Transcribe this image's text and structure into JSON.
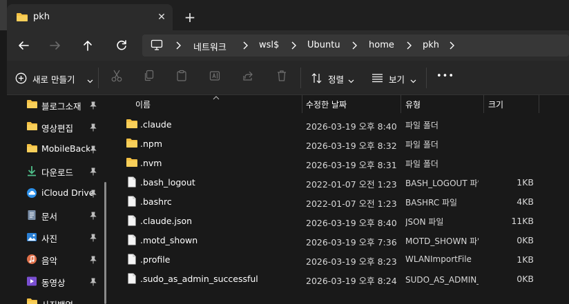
{
  "tab": {
    "title": "pkh",
    "close": "✕",
    "new": "+"
  },
  "address": {
    "crumbs": [
      "네트워크",
      "wsl$",
      "Ubuntu",
      "home",
      "pkh"
    ]
  },
  "toolbar": {
    "new_label": "새로 만들기",
    "sort_label": "정렬",
    "view_label": "보기",
    "more_label": "•••"
  },
  "sidebar": {
    "items": [
      {
        "label": "블로그소재",
        "icon": "folder-icon"
      },
      {
        "label": "영상편집",
        "icon": "folder-icon"
      },
      {
        "label": "MobileBackup",
        "icon": "folder-icon"
      },
      {
        "label": "다운로드",
        "icon": "download-icon"
      },
      {
        "label": "iCloud Drive",
        "icon": "icloud-icon"
      },
      {
        "label": "문서",
        "icon": "document-icon"
      },
      {
        "label": "사진",
        "icon": "picture-icon"
      },
      {
        "label": "음악",
        "icon": "music-icon"
      },
      {
        "label": "동영상",
        "icon": "video-icon"
      },
      {
        "label": "사진백업",
        "icon": "folder-icon"
      }
    ]
  },
  "columns": {
    "name": "이름",
    "modified": "수정한 날짜",
    "type": "유형",
    "size": "크기"
  },
  "files": [
    {
      "name": ".claude",
      "modified": "2026-03-19 오후 8:40",
      "type": "파일 폴더",
      "size": "",
      "kind": "folder"
    },
    {
      "name": ".npm",
      "modified": "2026-03-19 오후 8:32",
      "type": "파일 폴더",
      "size": "",
      "kind": "folder"
    },
    {
      "name": ".nvm",
      "modified": "2026-03-19 오후 8:31",
      "type": "파일 폴더",
      "size": "",
      "kind": "folder"
    },
    {
      "name": ".bash_logout",
      "modified": "2022-01-07 오전 1:23",
      "type": "BASH_LOGOUT 파일",
      "size": "1KB",
      "kind": "file"
    },
    {
      "name": ".bashrc",
      "modified": "2022-01-07 오전 1:23",
      "type": "BASHRC 파일",
      "size": "4KB",
      "kind": "file"
    },
    {
      "name": ".claude.json",
      "modified": "2026-03-19 오후 8:40",
      "type": "JSON 파일",
      "size": "11KB",
      "kind": "file"
    },
    {
      "name": ".motd_shown",
      "modified": "2026-03-19 오후 7:36",
      "type": "MOTD_SHOWN 파일",
      "size": "0KB",
      "kind": "file"
    },
    {
      "name": ".profile",
      "modified": "2026-03-19 오후 8:23",
      "type": "WLANImportFile",
      "size": "1KB",
      "kind": "file"
    },
    {
      "name": ".sudo_as_admin_successful",
      "modified": "2026-03-19 오후 8:24",
      "type": "SUDO_AS_ADMIN_SUCCESSFUL 파일",
      "size": "0KB",
      "kind": "file"
    }
  ],
  "colors": {
    "folder": "#f3c043",
    "accent": "#4cc2ff",
    "background": "#191919"
  }
}
